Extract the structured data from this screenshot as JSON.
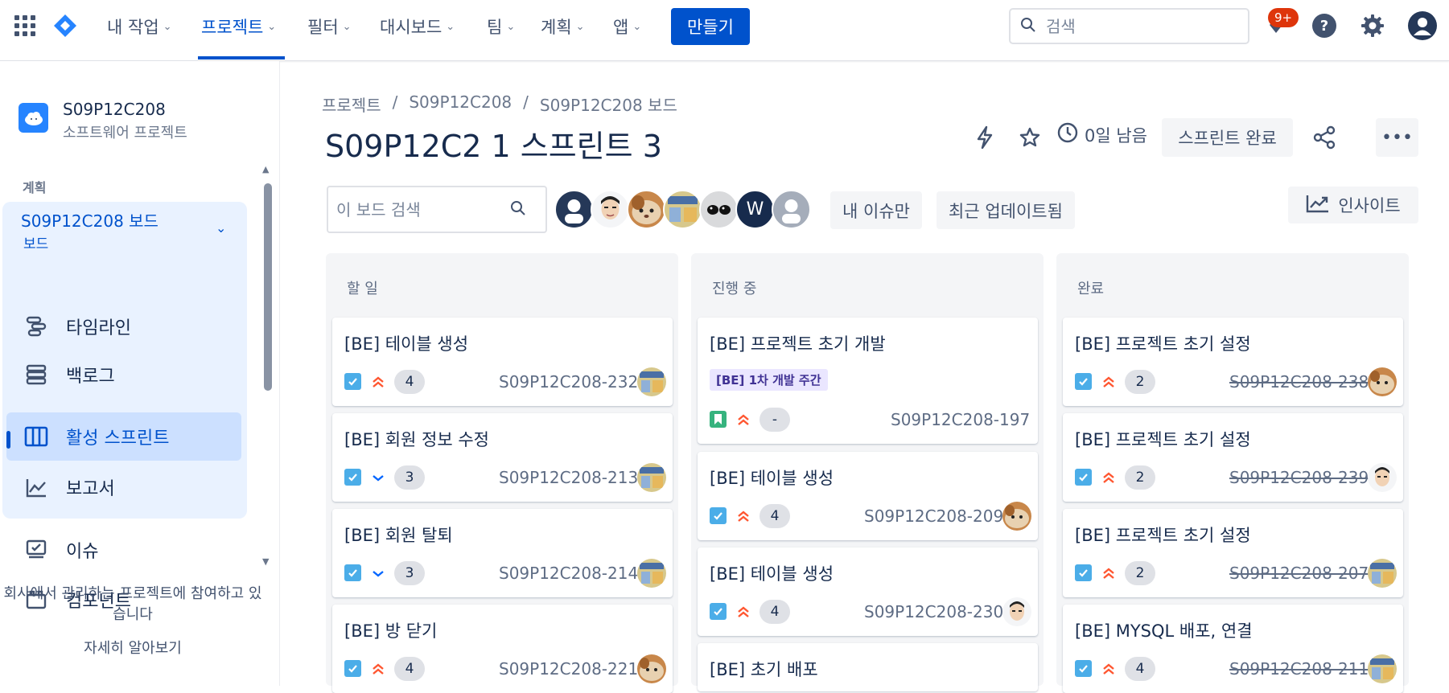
{
  "nav": {
    "items": [
      {
        "label": "내 작업"
      },
      {
        "label": "프로젝트"
      },
      {
        "label": "필터"
      },
      {
        "label": "대시보드"
      },
      {
        "label": "팀"
      },
      {
        "label": "계획"
      },
      {
        "label": "앱"
      }
    ],
    "create_label": "만들기",
    "search_placeholder": "검색",
    "notification_count": "9+"
  },
  "sidebar": {
    "project_name": "S09P12C208",
    "project_type": "소프트웨어 프로젝트",
    "section_label": "계획",
    "board_title": "S09P12C208 보드",
    "board_sub": "보드",
    "items": [
      {
        "label": "타임라인"
      },
      {
        "label": "백로그"
      },
      {
        "label": "활성 스프린트"
      },
      {
        "label": "보고서"
      },
      {
        "label": "이슈"
      },
      {
        "label": "컴포넌트"
      }
    ],
    "footer_text": "회사에서 관리하는 프로젝트에 참여하고 있습니다",
    "learn_more": "자세히 알아보기"
  },
  "main": {
    "breadcrumb": [
      "프로젝트",
      "/",
      "S09P12C208",
      "/",
      "S09P12C208 보드"
    ],
    "title": "S09P12C2 1 스프린트 3",
    "days_left": "0일 남음",
    "complete_sprint": "스프린트 완료",
    "board_search_placeholder": "이 보드 검색",
    "avatar_w": "W",
    "filter_mine": "내 이슈만",
    "filter_recent": "최근 업데이트됨",
    "insights": "인사이트"
  },
  "columns": [
    {
      "title": "할 일",
      "cards": [
        {
          "title": "[BE] 테이블 생성",
          "points": "4",
          "key": "S09P12C208-232",
          "priority": "high"
        },
        {
          "title": "[BE] 회원 정보 수정",
          "points": "3",
          "key": "S09P12C208-213",
          "priority": "low"
        },
        {
          "title": "[BE] 회원 탈퇴",
          "points": "3",
          "key": "S09P12C208-214",
          "priority": "low"
        },
        {
          "title": "[BE] 방 닫기",
          "points": "4",
          "key": "S09P12C208-221",
          "priority": "high"
        }
      ]
    },
    {
      "title": "진행 중",
      "cards": [
        {
          "title": "[BE] 프로젝트 초기 개발",
          "epic": "[BE] 1차 개발 주간",
          "points": "-",
          "key": "S09P12C208-197",
          "priority": "high"
        },
        {
          "title": "[BE] 테이블 생성",
          "points": "4",
          "key": "S09P12C208-209",
          "priority": "high"
        },
        {
          "title": "[BE] 테이블 생성",
          "points": "4",
          "key": "S09P12C208-230",
          "priority": "high"
        },
        {
          "title": "[BE] 초기 배포"
        }
      ]
    },
    {
      "title": "완료",
      "cards": [
        {
          "title": "[BE] 프로젝트 초기 설정",
          "points": "2",
          "key": "S09P12C208-238",
          "priority": "high"
        },
        {
          "title": "[BE] 프로젝트 초기 설정",
          "points": "2",
          "key": "S09P12C208-239",
          "priority": "high"
        },
        {
          "title": "[BE] 프로젝트 초기 설정",
          "points": "2",
          "key": "S09P12C208-207",
          "priority": "high"
        },
        {
          "title": "[BE] MYSQL 배포, 연결",
          "points": "4",
          "key": "S09P12C208-211",
          "priority": "high"
        }
      ]
    }
  ],
  "colors": {
    "brand": "#0052cc",
    "active_bg": "#cce0ff",
    "priority_high": "#ff5630",
    "priority_low": "#0065ff",
    "task_icon": "#4bade8",
    "story_icon": "#36b37e"
  }
}
